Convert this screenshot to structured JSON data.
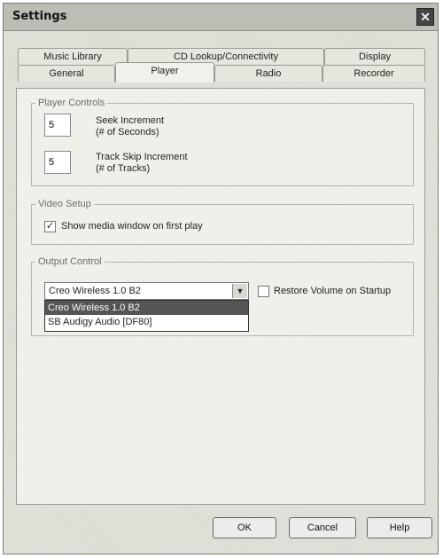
{
  "window": {
    "title": "Settings"
  },
  "tabs": {
    "row_back": [
      "Music Library",
      "CD Lookup/Connectivity",
      "Display"
    ],
    "row_front": [
      "General",
      "Player",
      "Radio",
      "Recorder"
    ],
    "selected": "Player"
  },
  "player_controls": {
    "legend": "Player Controls",
    "seek_value": "5",
    "seek_label": "Seek Increment",
    "seek_sub": "(# of Seconds)",
    "skip_value": "5",
    "skip_label": "Track Skip Increment",
    "skip_sub": "(# of Tracks)"
  },
  "video_setup": {
    "legend": "Video Setup",
    "show_window_label": "Show media window on first play",
    "show_window_checked": true
  },
  "output_control": {
    "legend": "Output Control",
    "selected_device": "Creo Wireless 1.0 B2",
    "options": [
      "Creo Wireless 1.0 B2",
      "SB Audigy Audio [DF80]"
    ],
    "restore_volume_label": "Restore Volume on Startup",
    "restore_volume_checked": false
  },
  "buttons": {
    "ok": "OK",
    "cancel": "Cancel",
    "help": "Help"
  }
}
